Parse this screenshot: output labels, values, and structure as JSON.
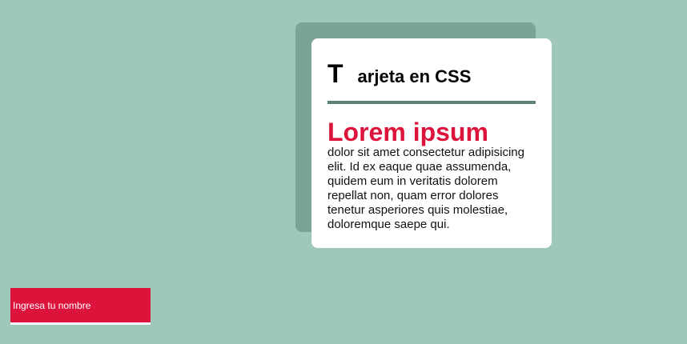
{
  "card": {
    "title_initial": "T",
    "title_rest": "arjeta en CSS",
    "heading": "Lorem ipsum",
    "body": "dolor sit amet consectetur adipisicing elit. Id ex eaque quae assumenda, quidem eum in veritatis dolorem repellat non, quam error dolores tenetur asperiores quis molestiae, doloremque saepe qui."
  },
  "form": {
    "name_placeholder": "Ingresa tu nombre",
    "name_value": ""
  },
  "colors": {
    "background": "#9fc8b9",
    "card_shadow": "#7aa595",
    "divider": "#5f8576",
    "accent": "#dc143c",
    "card_background": "#ffffff"
  }
}
